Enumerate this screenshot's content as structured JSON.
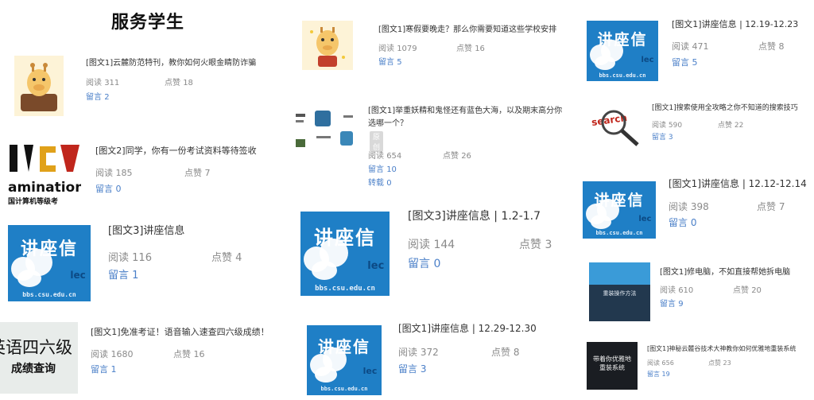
{
  "page": {
    "title": "服务学生"
  },
  "labels": {
    "read": "阅读",
    "like": "点赞",
    "comment": "留言",
    "repost": "转载"
  },
  "thumbs": {
    "lecture_big": "讲座信",
    "lecture_small": "lec",
    "lecture_url": "bbs.csu.edu.cn",
    "exam_top": "amination",
    "exam_bottom": "国计算机等级考",
    "cet_top": "英语四六级",
    "cet_bottom": "成绩查询",
    "search_word": "search",
    "repair_text": "重装操作方法",
    "reinstall_text": "带着你优雅地重装系统"
  },
  "articles": [
    {
      "id": "a1",
      "title": "[图文1]云麓防范特刊，教你如何火眼金睛防诈骗",
      "read": "311",
      "like": "18",
      "comment": "2"
    },
    {
      "id": "a2",
      "title": "[图文2]同学，你有一份考试资料等待签收",
      "read": "185",
      "like": "7",
      "comment": "0"
    },
    {
      "id": "a3",
      "title": "[图文3]讲座信息",
      "read": "116",
      "like": "4",
      "comment": "1"
    },
    {
      "id": "a4",
      "title": "[图文1]免准考证！语音输入速查四六级成绩！",
      "read": "1680",
      "like": "16",
      "comment": "1"
    },
    {
      "id": "b1",
      "title": "[图文1]寒假要晚走？那么你需要知道这些学校安排",
      "read": "1079",
      "like": "16",
      "comment": "5"
    },
    {
      "id": "b2",
      "title_line1": "[图文1]举重妖精和鬼怪还有蓝色大海，以及期末高分你",
      "title_line2": "选哪一个？",
      "badge": "原创",
      "read": "654",
      "like": "26",
      "comment": "10",
      "repost": "0"
    },
    {
      "id": "b3",
      "title": "[图文3]讲座信息 | 1.2-1.7",
      "read": "144",
      "like": "3",
      "comment": "0"
    },
    {
      "id": "b4",
      "title": "[图文1]讲座信息 | 12.29-12.30",
      "read": "372",
      "like": "8",
      "comment": "3"
    },
    {
      "id": "c1",
      "title": "[图文1]讲座信息 | 12.19-12.23",
      "read": "471",
      "like": "8",
      "comment": "5"
    },
    {
      "id": "c2",
      "title": "[图文1]搜索使用全攻略之你不知道的搜索技巧",
      "read": "590",
      "like": "22",
      "comment": "3"
    },
    {
      "id": "c3",
      "title": "[图文1]讲座信息 | 12.12-12.14",
      "read": "398",
      "like": "7",
      "comment": "0"
    },
    {
      "id": "c4",
      "title": "[图文1]修电脑，不如直接帮她拆电脑",
      "read": "610",
      "like": "20",
      "comment": "9"
    },
    {
      "id": "c5",
      "title": "[图文1]神秘云麓谷技术大神教你如何优雅地重装系统",
      "read": "656",
      "like": "23",
      "comment": "19"
    }
  ],
  "colors": {
    "link": "#4a7fc8",
    "meta": "#8a8a8a",
    "lecture_blue": "#1f7fc6"
  }
}
